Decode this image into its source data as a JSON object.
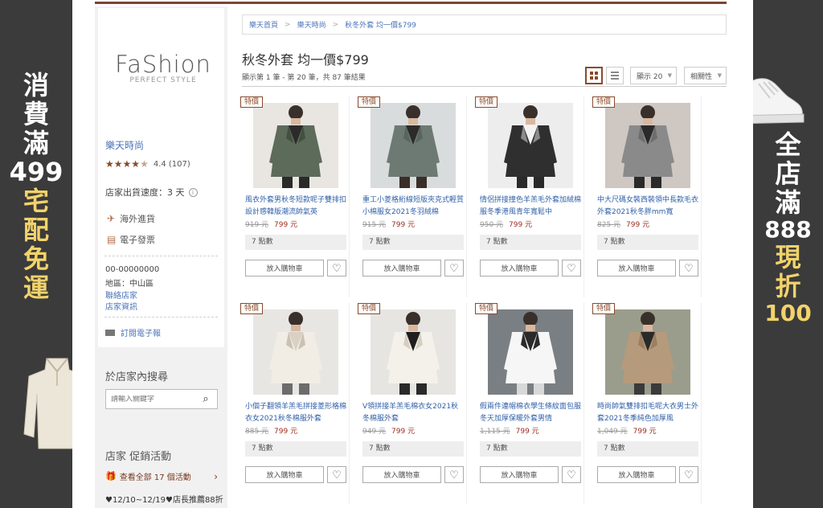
{
  "left_banner": {
    "chars": [
      "消",
      "費",
      "滿",
      "499",
      "宅",
      "配",
      "免",
      "運"
    ]
  },
  "right_banner": {
    "chars": [
      "全",
      "店",
      "滿",
      "888",
      "現",
      "折",
      "100"
    ]
  },
  "store": {
    "logo_main": "FaShion",
    "logo_sub": "PERFECT STYLE",
    "name": "樂天時尚",
    "rating_value": 4.4,
    "rating_text": "4.4 (107)",
    "shipping_speed": "店家出貨速度：3 天",
    "features": [
      "海外進貨",
      "電子發票"
    ],
    "phone": "00-00000000",
    "area": "地區：中山區",
    "contact_link": "聯絡店家",
    "info_link": "店家資訊",
    "subscribe": "訂閱電子報"
  },
  "search": {
    "title": "於店家內搜尋",
    "placeholder": "請輸入關鍵字"
  },
  "promo": {
    "title": "店家 促銷活動",
    "link": "查看全部 17 個活動",
    "note": "♥12/10~12/19♥店長推薦88折"
  },
  "breadcrumb": [
    "樂天首頁",
    "樂天時尚",
    "秋冬外套 均一價$799"
  ],
  "page": {
    "title": "秋冬外套 均一價$799",
    "result_line": "顯示第 1 筆 - 第 20 筆，共 87 筆結果"
  },
  "controls": {
    "per_page": "顯示 20",
    "sort": "相關性"
  },
  "product_ui": {
    "badge": "特價",
    "points": "7 點數",
    "cart_label": "放入購物車"
  },
  "colors": {
    "accent": "#8a4a2b",
    "link": "#3060a8",
    "price": "#9b2d1e",
    "banner_yellow": "#f2d36b"
  },
  "products": [
    {
      "name": "風衣外套男秋冬短款呢子雙排扣設計感韓版潮流帥氣英",
      "orig": "919 元",
      "price": "799 元"
    },
    {
      "name": "重工小菱格絎線短版夾克式輕質小棉服女2021冬羽絨棉",
      "orig": "915 元",
      "price": "799 元"
    },
    {
      "name": "情侶拼接撞色羊羔毛外套加絨棉服冬季港風青年寬鬆中",
      "orig": "950 元",
      "price": "799 元"
    },
    {
      "name": "中大尺碼女裝西裝領中長款毛衣外套2021秋冬胖mm寬",
      "orig": "825 元",
      "price": "799 元"
    },
    {
      "name": "小個子翻領羊羔毛拼接菱形格棉衣女2021秋冬棉服外套",
      "orig": "885 元",
      "price": "799 元"
    },
    {
      "name": "V領拼接羊羔毛棉衣女2021秋冬棉服外套",
      "orig": "949 元",
      "price": "799 元"
    },
    {
      "name": "假兩件連帽棉衣學生條紋面包服冬天加厚保暖外套男情",
      "orig": "1,115 元",
      "price": "799 元"
    },
    {
      "name": "時尚帥氣雙排扣毛呢大衣男士外套2021冬季純色加厚風",
      "orig": "1,049 元",
      "price": "799 元"
    }
  ]
}
